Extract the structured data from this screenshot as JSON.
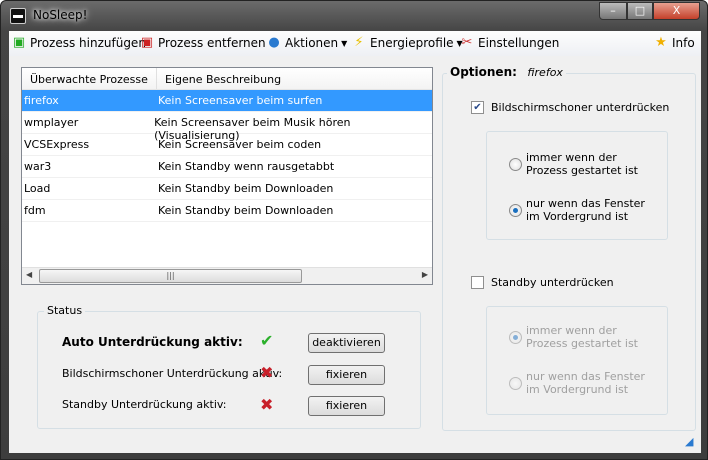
{
  "window": {
    "title": "NoSleep!",
    "minimize": "–",
    "maximize": "□",
    "close": "X"
  },
  "toolbar": {
    "add": "Prozess hinzufügen",
    "remove": "Prozess entfernen",
    "actions": "Aktionen",
    "power": "Energieprofile",
    "settings": "Einstellungen",
    "info": "Info"
  },
  "list": {
    "headers": [
      "Überwachte Prozesse",
      "Eigene Beschreibung"
    ],
    "rows": [
      [
        "firefox",
        "Kein Screensaver beim surfen"
      ],
      [
        "wmplayer",
        "Kein Screensaver beim Musik hören (Visualisierung)"
      ],
      [
        "VCSExpress",
        "Kein Screensaver beim coden"
      ],
      [
        "war3",
        "Kein Standby wenn rausgetabbt"
      ],
      [
        "Load",
        "Kein Standby beim Downloaden"
      ],
      [
        "fdm",
        "Kein Standby beim Downloaden"
      ]
    ],
    "selected": 0
  },
  "status": {
    "title": "Status",
    "auto_label": "Auto Unterdrückung aktiv:",
    "screensaver_label": "Bildschirmschoner Unterdrückung aktiv:",
    "standby_label": "Standby Unterdrückung aktiv:",
    "deactivate": "deaktivieren",
    "fix1": "fixieren",
    "fix2": "fixieren"
  },
  "options": {
    "title": "Optionen:",
    "process": "firefox",
    "screensaver": {
      "label": "Bildschirmschoner unterdrücken",
      "checked": true,
      "opt1": [
        "immer wenn der",
        "Prozess gestartet ist"
      ],
      "opt2": [
        "nur wenn das Fenster",
        "im Vordergrund ist"
      ],
      "selected": 2
    },
    "standby": {
      "label": "Standby unterdrücken",
      "checked": false,
      "opt1": [
        "immer wenn der",
        "Prozess gestartet ist"
      ],
      "opt2": [
        "nur wenn das Fenster",
        "im Vordergrund ist"
      ]
    }
  }
}
